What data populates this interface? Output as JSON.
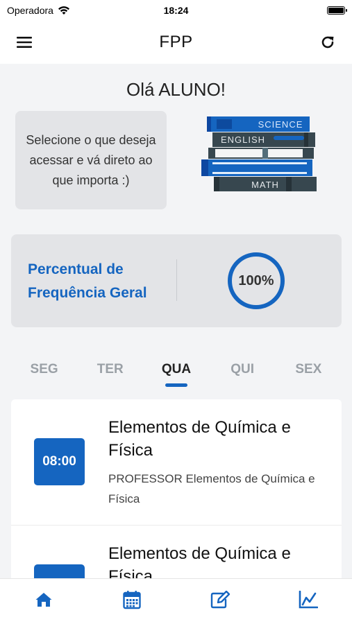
{
  "status": {
    "carrier": "Operadora",
    "time": "18:24"
  },
  "nav": {
    "title": "FPP",
    "menu_icon": "hamburger-menu-icon",
    "refresh_icon": "refresh-icon"
  },
  "home": {
    "greeting": "Olá ALUNO!",
    "hint": "Selecione o que deseja acessar e vá direto ao que importa :)",
    "books": {
      "science": "SCIENCE",
      "english": "ENGLISH",
      "math": "MATH"
    },
    "frequency": {
      "label": "Percentual de Frequência Geral",
      "value": "100%"
    }
  },
  "days": [
    {
      "label": "SEG",
      "active": false
    },
    {
      "label": "TER",
      "active": false
    },
    {
      "label": "QUA",
      "active": true
    },
    {
      "label": "QUI",
      "active": false
    },
    {
      "label": "SEX",
      "active": false
    }
  ],
  "classes": [
    {
      "time": "08:00",
      "title": "Elementos de Química e Física",
      "professor": "PROFESSOR Elementos de Química e Física"
    },
    {
      "time": "",
      "title": "Elementos de Química e Física",
      "professor": ""
    }
  ],
  "tabbar": [
    {
      "icon": "home-icon"
    },
    {
      "icon": "calendar-icon"
    },
    {
      "icon": "edit-icon"
    },
    {
      "icon": "chart-icon"
    }
  ],
  "colors": {
    "accent": "#1565c0",
    "background": "#f3f4f6",
    "card": "#e3e4e7"
  }
}
